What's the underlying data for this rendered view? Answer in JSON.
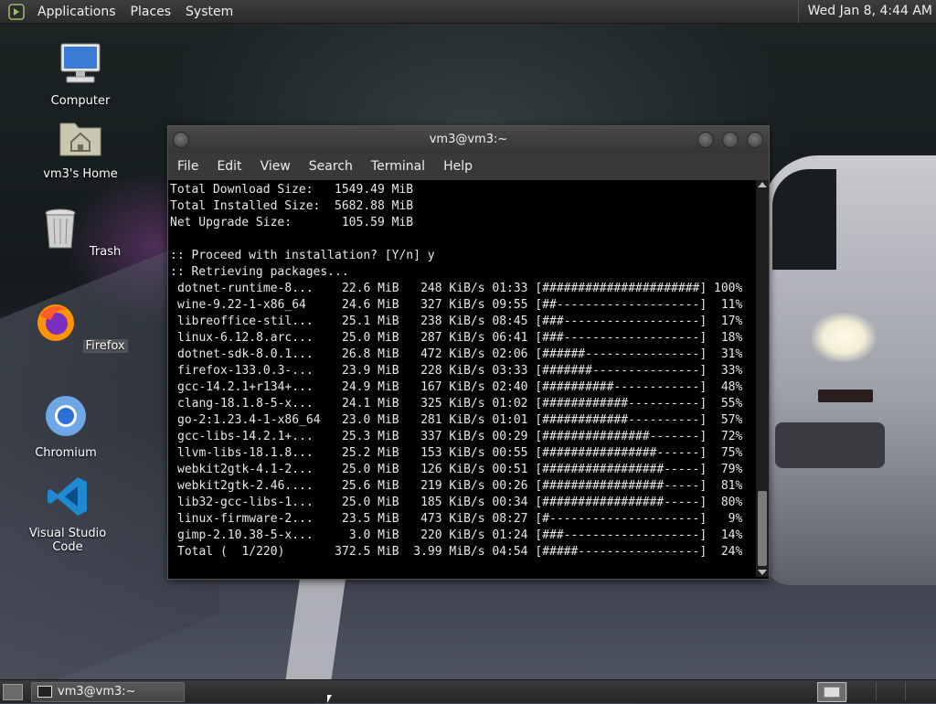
{
  "top_panel": {
    "menus": [
      "Applications",
      "Places",
      "System"
    ],
    "clock": "Wed Jan  8,  4:44 AM"
  },
  "desktop_icons": {
    "computer": "Computer",
    "home": "vm3's Home",
    "trash": "Trash",
    "firefox": "Firefox",
    "chromium": "Chromium",
    "vscode": "Visual Studio Code"
  },
  "terminal": {
    "title": "vm3@vm3:~",
    "menu": [
      "File",
      "Edit",
      "View",
      "Search",
      "Terminal",
      "Help"
    ],
    "header_lines": [
      "Total Download Size:   1549.49 MiB",
      "Total Installed Size:  5682.88 MiB",
      "Net Upgrade Size:       105.59 MiB",
      "",
      ":: Proceed with installation? [Y/n] y",
      ":: Retrieving packages..."
    ],
    "progress_lines": [
      "dotnet-runtime-8...    22.6 MiB   248 KiB/s 01:33 [######################] 100%",
      "wine-9.22-1-x86_64     24.6 MiB   327 KiB/s 09:55 [##--------------------]  11%",
      "libreoffice-stil...    25.1 MiB   238 KiB/s 08:45 [###-------------------]  17%",
      "linux-6.12.8.arc...    25.0 MiB   287 KiB/s 06:41 [###-------------------]  18%",
      "dotnet-sdk-8.0.1...    26.8 MiB   472 KiB/s 02:06 [######----------------]  31%",
      "firefox-133.0.3-...    23.9 MiB   228 KiB/s 03:33 [#######---------------]  33%",
      "gcc-14.2.1+r134+...    24.9 MiB   167 KiB/s 02:40 [##########------------]  48%",
      "clang-18.1.8-5-x...    24.1 MiB   325 KiB/s 01:02 [############----------]  55%",
      "go-2:1.23.4-1-x86_64   23.0 MiB   281 KiB/s 01:01 [############----------]  57%",
      "gcc-libs-14.2.1+...    25.3 MiB   337 KiB/s 00:29 [###############-------]  72%",
      "llvm-libs-18.1.8...    25.2 MiB   153 KiB/s 00:55 [################------]  75%",
      "webkit2gtk-4.1-2...    25.0 MiB   126 KiB/s 00:51 [#################-----]  79%",
      "webkit2gtk-2.46....    25.6 MiB   219 KiB/s 00:26 [#################-----]  81%",
      "lib32-gcc-libs-1...    25.0 MiB   185 KiB/s 00:34 [#################-----]  80%",
      "linux-firmware-2...    23.5 MiB   473 KiB/s 08:27 [#---------------------]   9%",
      "gimp-2.10.38-5-x...     3.0 MiB   220 KiB/s 01:24 [###-------------------]  14%",
      "Total (  1/220)       372.5 MiB  3.99 MiB/s 04:54 [#####-----------------]  24%"
    ]
  },
  "bottom_panel": {
    "task_label": "vm3@vm3:~"
  }
}
